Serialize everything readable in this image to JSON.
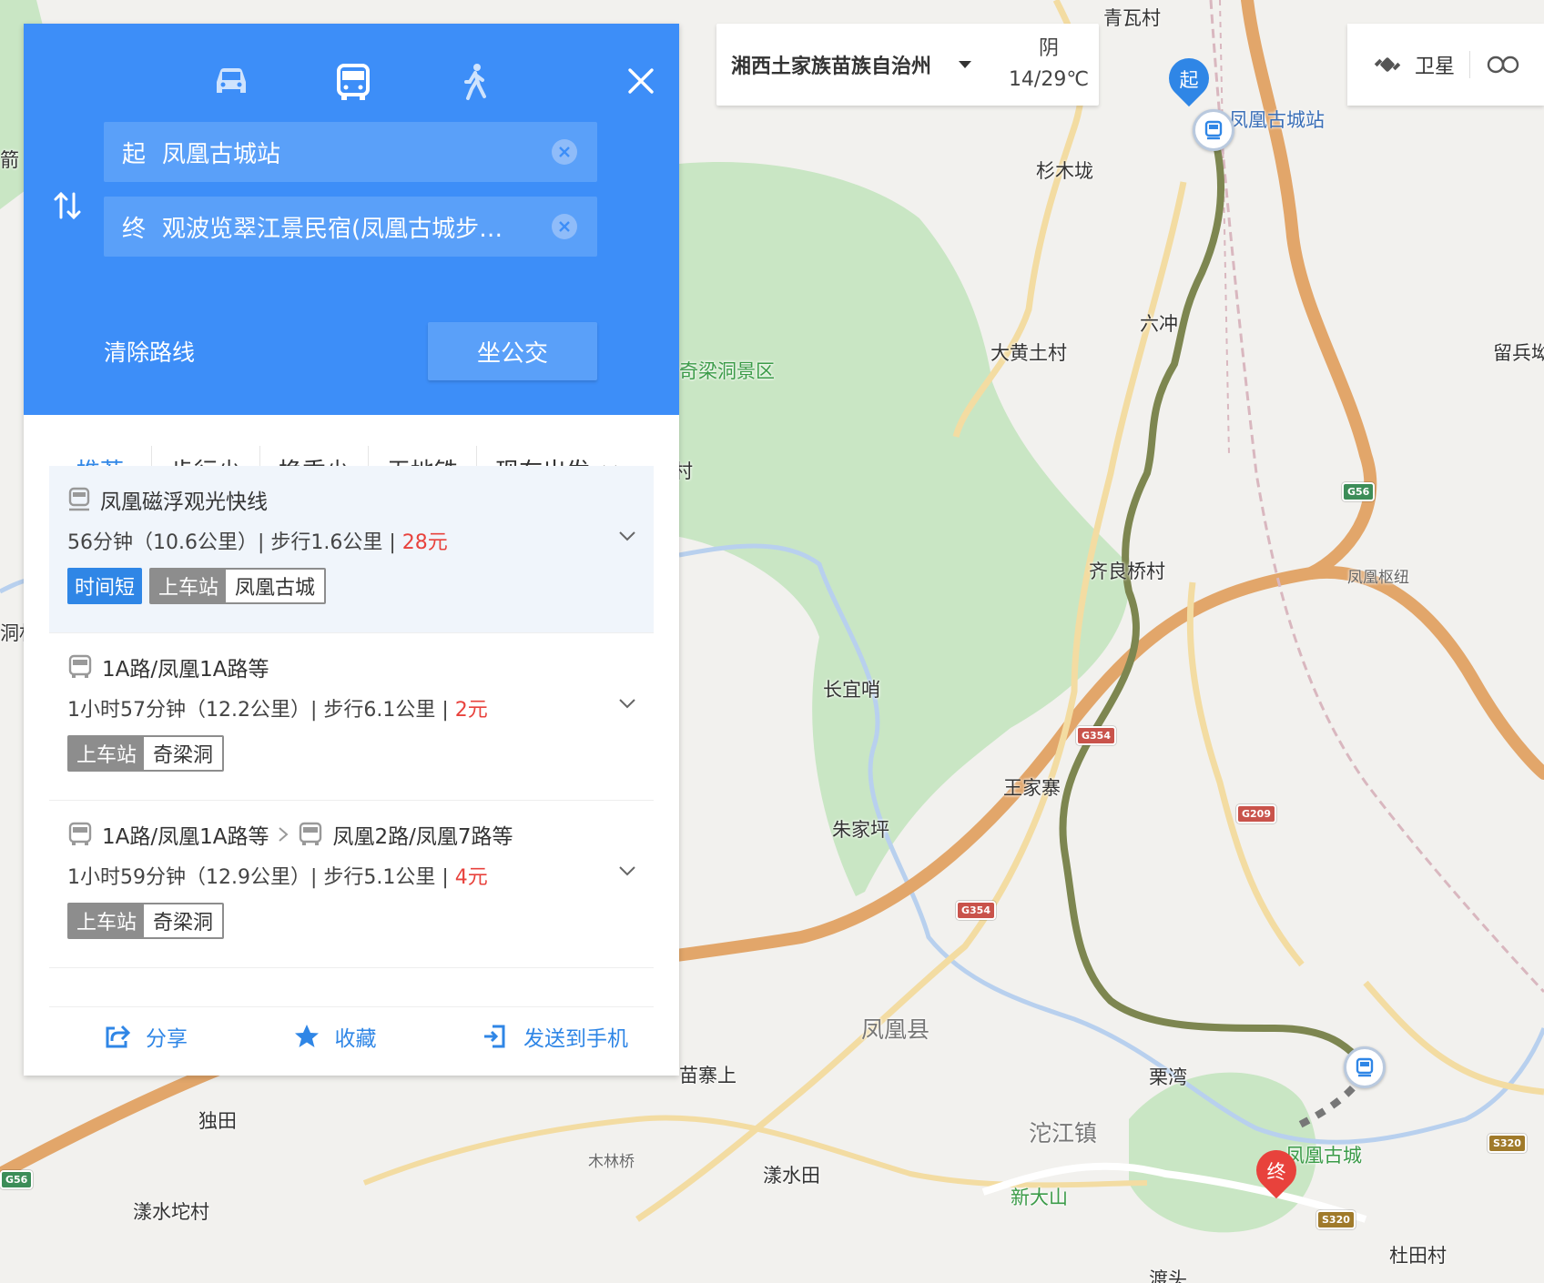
{
  "panel": {
    "modes": [
      "car-icon",
      "bus-icon",
      "walk-icon"
    ],
    "start": {
      "tag": "起",
      "value": "凤凰古城站"
    },
    "end": {
      "tag": "终",
      "value": "观波览翠江景民宿(凤凰古城步…"
    },
    "clear_route": "清除路线",
    "search_button": "坐公交",
    "filters": [
      "推荐",
      "步行少",
      "换乘少",
      "无地铁",
      "现在出发"
    ],
    "routes": [
      {
        "title": "凤凰磁浮观光快线",
        "meta": "56分钟（10.6公里）| 步行1.6公里 | ",
        "price": "28元",
        "tag_fast": "时间短",
        "board_key": "上车站",
        "board_val": "凤凰古城"
      },
      {
        "title": "1A路/凤凰1A路等",
        "meta": "1小时57分钟（12.2公里）| 步行6.1公里 | ",
        "price": "2元",
        "board_key": "上车站",
        "board_val": "奇梁洞"
      },
      {
        "title": "1A路/凤凰1A路等",
        "title2": "凤凰2路/凤凰7路等",
        "meta": "1小时59分钟（12.9公里）| 步行5.1公里 | ",
        "price": "4元",
        "board_key": "上车站",
        "board_val": "奇梁洞"
      }
    ],
    "footer": {
      "share": "分享",
      "favorite": "收藏",
      "send": "发送到手机"
    }
  },
  "region": {
    "name": "湘西土家族苗族自治州",
    "weather": "阴",
    "temp": "14/29℃"
  },
  "layers": {
    "satellite": "卫星"
  },
  "map": {
    "pins": {
      "start": "起",
      "end": "终"
    },
    "labels": {
      "qingwa": "青瓦村",
      "station": "凤凰古城站",
      "shanmu": "杉木垅",
      "liuchong": "六冲",
      "dahuang": "大黄土村",
      "liubing": "留兵坳",
      "qiliangdong": "奇梁洞景区",
      "qiliangqiao": "齐良桥村",
      "hub": "凤凰枢纽",
      "changyi": "长宜哨",
      "wangjia": "王家寨",
      "zhujia": "朱家坪",
      "county": "凤凰县",
      "lijwan": "栗湾",
      "tuojiang": "沱江镇",
      "oldtown": "凤凰古城",
      "xinda": "新大山",
      "miaozhai": "苗寨上",
      "dutian": "独田",
      "mulin": "木林桥",
      "yangshuitian": "漾水田",
      "yangshuituo": "漾水坨村",
      "dutianCun": "杜田村",
      "jian": "箭",
      "tong": "洞村",
      "cun": "村",
      "du": "渡头"
    },
    "shields": [
      "G56",
      "G56",
      "G354",
      "G354",
      "G209",
      "S320",
      "S320"
    ]
  }
}
